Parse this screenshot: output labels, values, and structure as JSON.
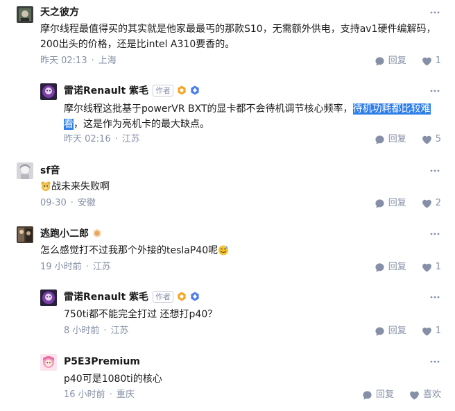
{
  "comments": [
    {
      "author": "天之彼方",
      "text": "摩尔线程最值得买的其实就是他家最最丐的那款S10，无需额外供电，支持av1硬件编解码，200出头的价格，还是比intel A310要香的。",
      "time": "昨天 02:13",
      "location": "上海",
      "reply_label": "回复",
      "likes": "1"
    },
    {
      "author": "雷诺Renault 紫毛",
      "author_tag": "作者",
      "text_before": "摩尔线程这批基于powerVR BXT的显卡都不会待机调节核心频率，",
      "text_highlight": "待机功耗都比较难看",
      "text_after": "，这是作为亮机卡的最大缺点。",
      "time": "昨天 02:16",
      "location": "江苏",
      "reply_label": "回复",
      "likes": "5"
    },
    {
      "author": "sf音",
      "text": "战未来失败啊",
      "time": "09-30",
      "location": "安徽",
      "reply_label": "回复",
      "likes": "2"
    },
    {
      "author": "逃跑小二郎",
      "text": "怎么感觉打不过我那个外接的teslaP40呢",
      "time": "19 小时前",
      "location": "江苏",
      "reply_label": "回复",
      "likes": "1"
    },
    {
      "author": "雷诺Renault 紫毛",
      "author_tag": "作者",
      "text": "750ti都不能完全打过 还想打p40？",
      "time": "8 小时前",
      "location": "江苏",
      "reply_label": "回复",
      "likes": "1"
    },
    {
      "author": "P5E3Premium",
      "text": "p40可是1080ti的核心",
      "time": "16 小时前",
      "location": "重庆",
      "reply_label": "回复",
      "like_label": "喜欢"
    }
  ],
  "colors": {
    "meta": "#8590a6",
    "highlight": "#2f7fe8",
    "badge_orange": "#f5a623",
    "badge_blue": "#4a7cf0"
  }
}
